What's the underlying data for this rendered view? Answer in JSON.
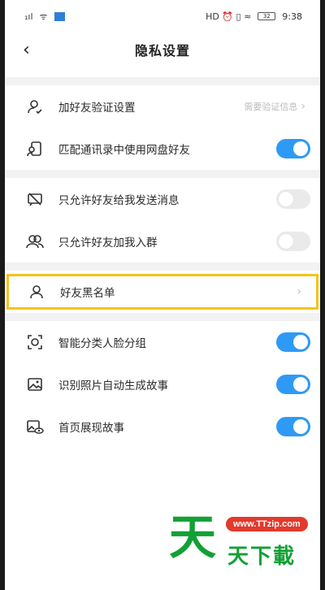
{
  "status_bar": {
    "signal": "₁ıl",
    "wifi": "ᯤ",
    "icons_right": "HD ⏰ ▯ ≈",
    "battery": "32",
    "time": "9:38"
  },
  "header": {
    "title": "隐私设置"
  },
  "rows": [
    {
      "label": "加好友验证设置",
      "value": "需要验证信息",
      "icon": "user-check-icon"
    },
    {
      "label": "匹配通讯录中使用网盘好友",
      "toggle": true,
      "icon": "contacts-icon"
    },
    {
      "label": "只允许好友给我发送消息",
      "toggle": false,
      "icon": "message-off-icon"
    },
    {
      "label": "只允许好友加我入群",
      "toggle": false,
      "icon": "group-icon"
    },
    {
      "label": "好友黑名单",
      "icon": "user-icon"
    },
    {
      "label": "智能分类人脸分组",
      "toggle": true,
      "icon": "face-scan-icon"
    },
    {
      "label": "识别照片自动生成故事",
      "toggle": true,
      "icon": "photo-icon"
    },
    {
      "label": "首页展现故事",
      "toggle": true,
      "icon": "photo-eye-icon"
    }
  ],
  "watermark": {
    "big": "天",
    "url": "www.TTzip.com",
    "name": "天下載"
  },
  "colors": {
    "accent": "#2e9af5",
    "highlight": "#f5c518",
    "wm_green": "#12a035",
    "wm_red": "#e23a2d"
  }
}
